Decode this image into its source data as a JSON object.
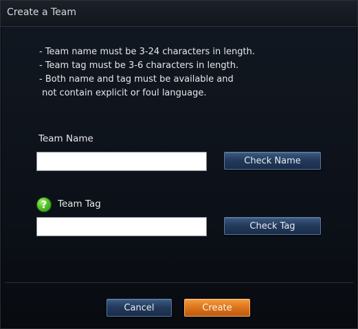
{
  "dialog": {
    "title": "Create a Team"
  },
  "rules": [
    "- Team name must be 3-24 characters in length.",
    "- Team tag must be 3-6 characters in length.",
    "- Both name and tag must be available and",
    " not contain explicit or foul language."
  ],
  "team_name": {
    "label": "Team Name",
    "value": "",
    "check_button": "Check Name"
  },
  "team_tag": {
    "label": "Team Tag",
    "help_icon": "question-mark-icon",
    "help_glyph": "?",
    "value": "",
    "check_button": "Check Tag"
  },
  "footer": {
    "cancel_label": "Cancel",
    "create_label": "Create"
  },
  "colors": {
    "accent_blue": "#22395a",
    "accent_orange": "#d9701a",
    "help_green": "#53c12a"
  }
}
